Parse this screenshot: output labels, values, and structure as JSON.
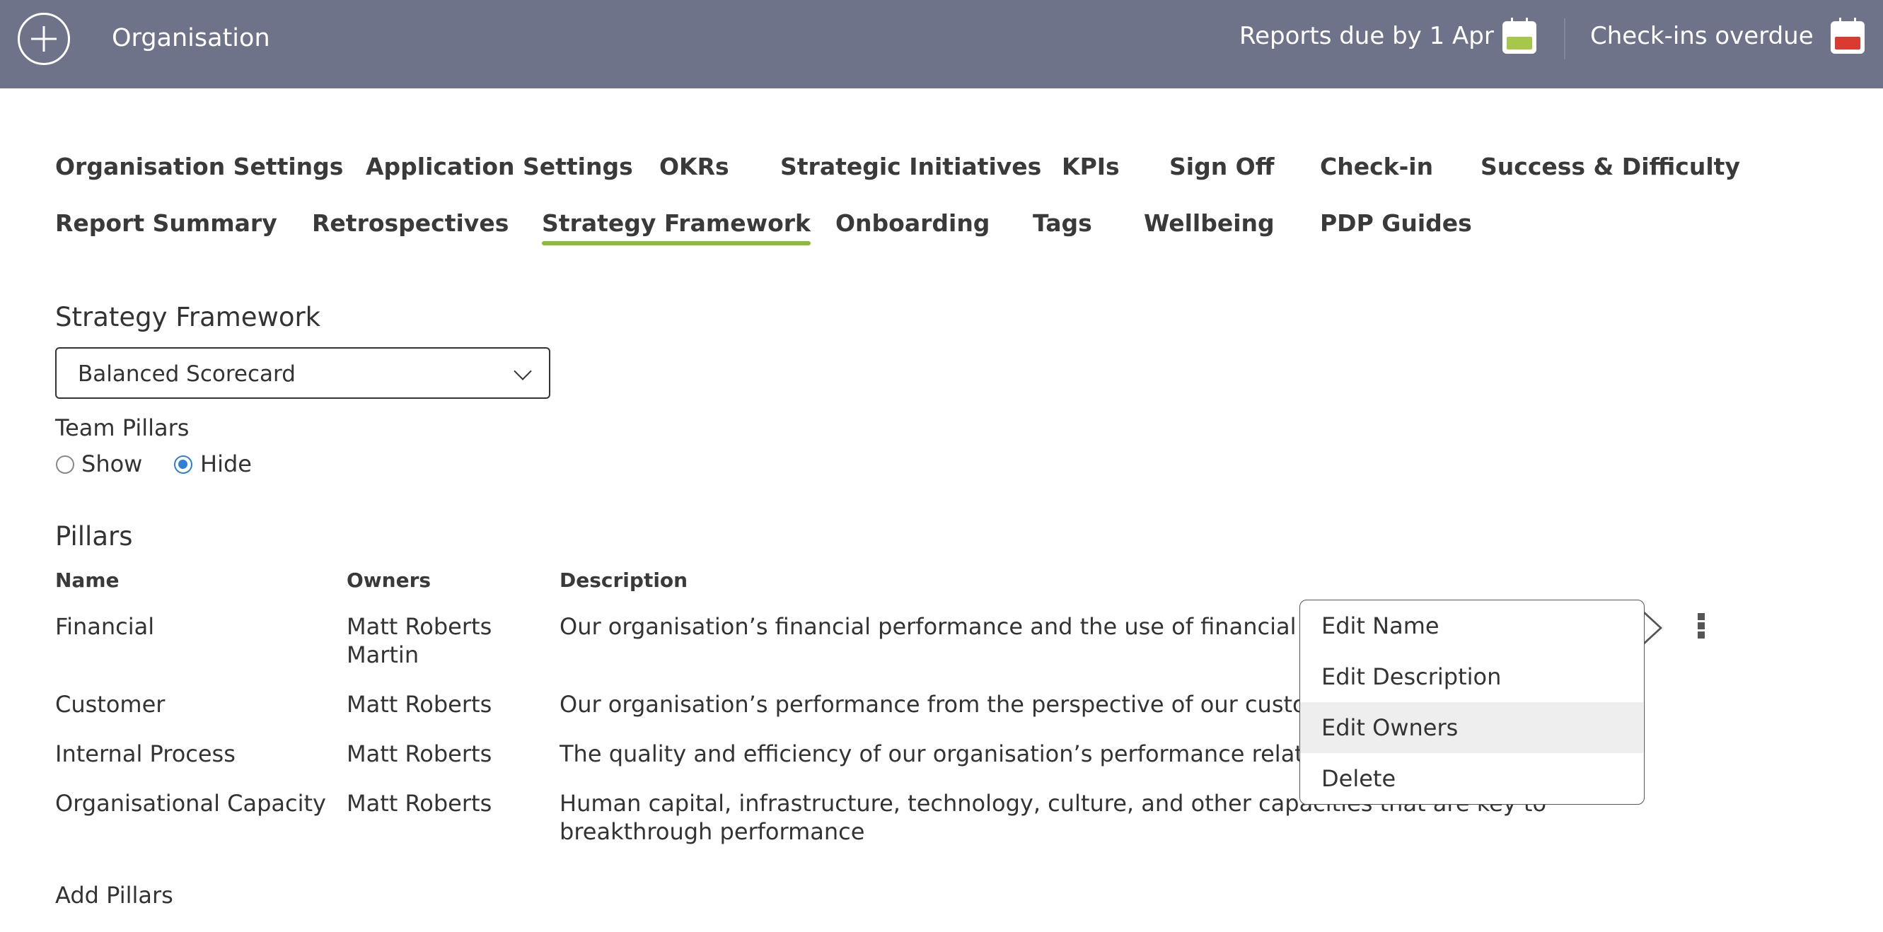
{
  "header": {
    "brand": "Organisation",
    "reports_due": "Reports due by 1 Apr",
    "checkins_overdue": "Check-ins overdue",
    "reports_icon_color": "#a6c64c",
    "checkins_icon_color": "#d93b30"
  },
  "tabs": {
    "row1": [
      "Organisation Settings",
      "Application Settings",
      "OKRs",
      "Strategic Initiatives",
      "KPIs",
      "Sign Off",
      "Check-in",
      "Success & Difficulty"
    ],
    "row2": [
      "Report Summary",
      "Retrospectives",
      "Strategy Framework",
      "Onboarding",
      "Tags",
      "Wellbeing",
      "PDP Guides"
    ],
    "active": "Strategy Framework",
    "active_underline_color": "#8cbd35"
  },
  "framework": {
    "title": "Strategy Framework",
    "selected": "Balanced Scorecard",
    "team_pillars_label": "Team Pillars",
    "show_label": "Show",
    "hide_label": "Hide",
    "team_pillars_value": "Hide"
  },
  "pillars": {
    "title": "Pillars",
    "columns": [
      "Name",
      "Owners",
      "Description"
    ],
    "rows": [
      {
        "name": "Financial",
        "owners": "Matt Roberts\nMartin",
        "description": "Our organisation’s financial performance and the use of financial"
      },
      {
        "name": "Customer",
        "owners": "Matt Roberts",
        "description": "Our organisation’s performance from the perspective of our custo"
      },
      {
        "name": "Internal Process",
        "owners": "Matt Roberts",
        "description": "The quality and efficiency of our organisation’s performance relate"
      },
      {
        "name": "Organisational Capacity",
        "owners": "Matt Roberts",
        "description": "Human capital, infrastructure, technology, culture, and other capacities that are key to",
        "description2": "breakthrough performance"
      }
    ],
    "add_label": "Add Pillars"
  },
  "context_menu": {
    "items": [
      "Edit Name",
      "Edit Description",
      "Edit Owners",
      "Delete"
    ],
    "highlighted": "Edit Owners"
  }
}
